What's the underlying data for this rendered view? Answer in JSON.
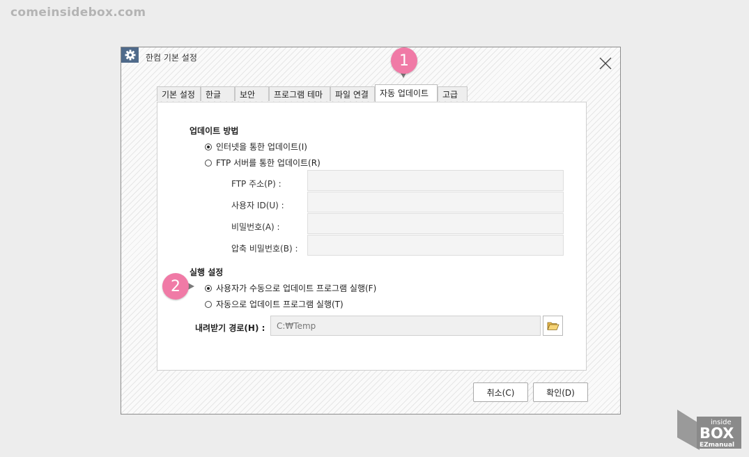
{
  "watermark": "comeinsidebox.com",
  "dialog": {
    "title": "한컴 기본 설정",
    "tabs": [
      {
        "label": "기본 설정"
      },
      {
        "label": "한글"
      },
      {
        "label": "보안"
      },
      {
        "label": "프로그램 테마"
      },
      {
        "label": "파일 연결"
      },
      {
        "label": "자동 업데이트",
        "active": true
      },
      {
        "label": "고급"
      }
    ],
    "update_method": {
      "title": "업데이트 방법",
      "options": [
        {
          "label": "인터넷을 통한 업데이트(I)",
          "selected": true
        },
        {
          "label": "FTP 서버를 통한 업데이트(R)",
          "selected": false
        }
      ],
      "fields": [
        {
          "label": "FTP 주소(P) :",
          "value": ""
        },
        {
          "label": "사용자 ID(U) :",
          "value": ""
        },
        {
          "label": "비밀번호(A) :",
          "value": ""
        },
        {
          "label": "압축 비밀번호(B) :",
          "value": ""
        }
      ]
    },
    "run_settings": {
      "title": "실행 설정",
      "options": [
        {
          "label": "사용자가 수동으로 업데이트 프로그램 실행(F)",
          "selected": true
        },
        {
          "label": "자동으로 업데이트 프로그램 실행(T)",
          "selected": false
        }
      ]
    },
    "download_path": {
      "label": "내려받기 경로(H) :",
      "value": "C:₩Temp"
    },
    "buttons": {
      "cancel": "취소(C)",
      "ok": "확인(D)"
    }
  },
  "callouts": [
    "1",
    "2"
  ],
  "logo": {
    "line1": "inside",
    "line2": "BOX",
    "line3": "EZmanual"
  },
  "colors": {
    "accent_pink": "#f07aa6",
    "title_icon_bg": "#4f6a8a"
  }
}
